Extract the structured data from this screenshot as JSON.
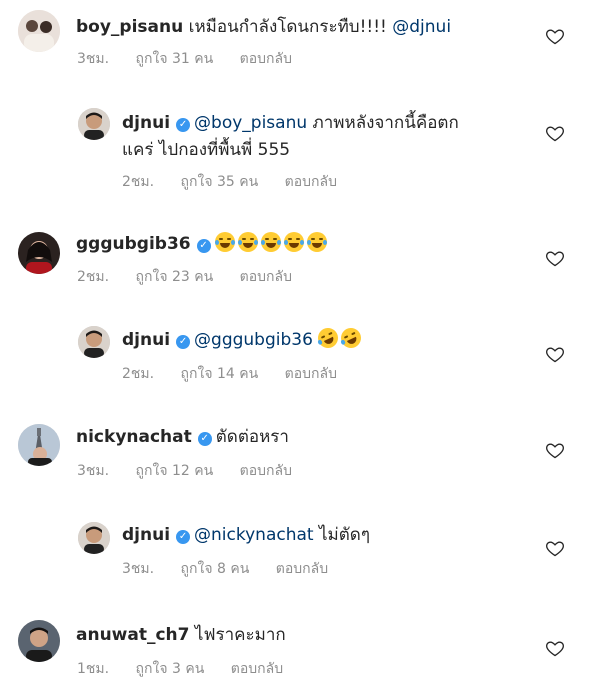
{
  "comments": [
    {
      "user": "boy_pisanu",
      "verified": false,
      "text": "เหมือนกำลังโดนกระทืบ!!!!",
      "mention": "@djnui",
      "time": "3ชม.",
      "likes": "ถูกใจ 31 คน",
      "reply": "ตอบกลับ"
    },
    {
      "user": "djnui",
      "verified": true,
      "mention": "@boy_pisanu",
      "text_line1": "ภาพหลังจากนี้คือตก",
      "text_line2": "แคร่ ไปกองที่พื้นพี่ 555",
      "time": "2ชม.",
      "likes": "ถูกใจ 35 คน",
      "reply": "ตอบกลับ"
    },
    {
      "user": "gggubgib36",
      "verified": true,
      "time": "2ชม.",
      "likes": "ถูกใจ 23 คน",
      "reply": "ตอบกลับ",
      "emoji": [
        "joy-emoji",
        "joy-emoji",
        "joy-emoji",
        "joy-emoji",
        "joy-emoji"
      ]
    },
    {
      "user": "djnui",
      "verified": true,
      "mention": "@gggubgib36",
      "time": "2ชม.",
      "likes": "ถูกใจ 14 คน",
      "reply": "ตอบกลับ",
      "emoji": [
        "rofl-emoji",
        "rofl-emoji"
      ]
    },
    {
      "user": "nickynachat",
      "verified": true,
      "text": "ตัดต่อหรา",
      "time": "3ชม.",
      "likes": "ถูกใจ 12 คน",
      "reply": "ตอบกลับ"
    },
    {
      "user": "djnui",
      "verified": true,
      "mention": "@nickynachat",
      "text": "ไม่ตัดๆ",
      "time": "3ชม.",
      "likes": "ถูกใจ 8 คน",
      "reply": "ตอบกลับ"
    },
    {
      "user": "anuwat_ch7",
      "verified": false,
      "text": "ไฟราคะมาก",
      "time": "1ชม.",
      "likes": "ถูกใจ 3 คน",
      "reply": "ตอบกลับ"
    }
  ],
  "colors": {
    "verified": "#3897f0",
    "mention": "#00376b",
    "meta": "#8e8e8e",
    "emoji": "#ffcc33"
  }
}
